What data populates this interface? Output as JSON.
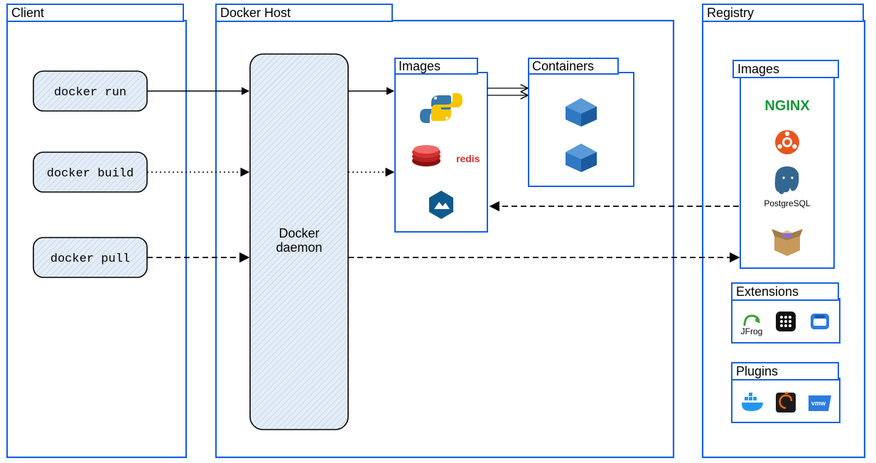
{
  "client": {
    "title": "Client",
    "commands": [
      "docker run",
      "docker build",
      "docker pull"
    ]
  },
  "host": {
    "title": "Docker Host",
    "daemon_label_1": "Docker",
    "daemon_label_2": "daemon",
    "images_title": "Images",
    "containers_title": "Containers",
    "image_icons": [
      "python",
      "redis",
      "alpine"
    ]
  },
  "registry": {
    "title": "Registry",
    "images_title": "Images",
    "extensions_title": "Extensions",
    "plugins_title": "Plugins",
    "nginx_label": "NGINX",
    "postgres_label": "PostgreSQL",
    "jfrog_label": "JFrog",
    "vmw_label": "vmw"
  },
  "colors": {
    "frame": "#1860e5",
    "box_fill": "#e4edf7",
    "hatch": "#4a7fc2",
    "arrow": "#000000"
  }
}
